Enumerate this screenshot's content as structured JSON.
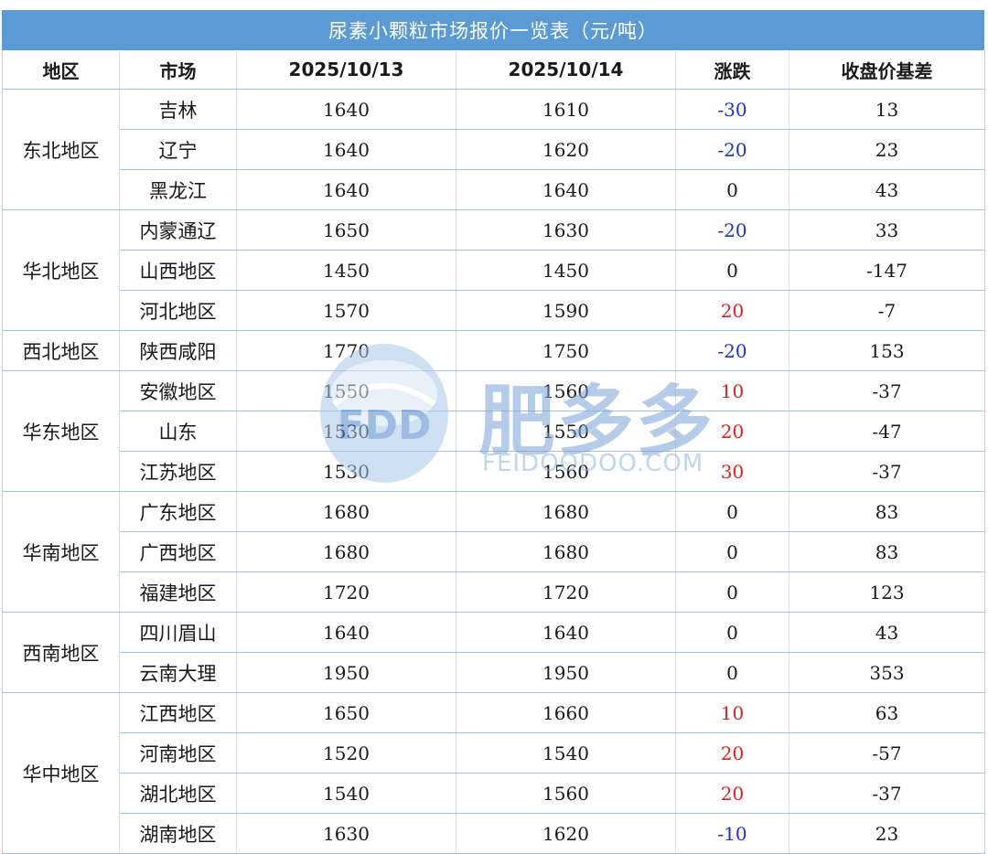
{
  "title": "尿素小颗粒市场报价一览表（元/吨）",
  "headers": [
    "地区",
    "市场",
    "2025/10/13",
    "2025/10/14",
    "涨跌",
    "收盘价基差"
  ],
  "groups": [
    {
      "region": "东北地区",
      "rows": [
        {
          "market": "吉林",
          "d1": "1640",
          "d2": "1610",
          "change": "-30",
          "basis": "13"
        },
        {
          "market": "辽宁",
          "d1": "1640",
          "d2": "1620",
          "change": "-20",
          "basis": "23"
        },
        {
          "market": "黑龙江",
          "d1": "1640",
          "d2": "1640",
          "change": "0",
          "basis": "43"
        }
      ]
    },
    {
      "region": "华北地区",
      "rows": [
        {
          "market": "内蒙通辽",
          "d1": "1650",
          "d2": "1630",
          "change": "-20",
          "basis": "33"
        },
        {
          "market": "山西地区",
          "d1": "1450",
          "d2": "1450",
          "change": "0",
          "basis": "-147"
        },
        {
          "market": "河北地区",
          "d1": "1570",
          "d2": "1590",
          "change": "20",
          "basis": "-7"
        }
      ]
    },
    {
      "region": "西北地区",
      "rows": [
        {
          "market": "陕西咸阳",
          "d1": "1770",
          "d2": "1750",
          "change": "-20",
          "basis": "153"
        }
      ]
    },
    {
      "region": "华东地区",
      "rows": [
        {
          "market": "安徽地区",
          "d1": "1550",
          "d2": "1560",
          "change": "10",
          "basis": "-37"
        },
        {
          "market": "山东",
          "d1": "1530",
          "d2": "1550",
          "change": "20",
          "basis": "-47"
        },
        {
          "market": "江苏地区",
          "d1": "1530",
          "d2": "1560",
          "change": "30",
          "basis": "-37"
        }
      ]
    },
    {
      "region": "华南地区",
      "rows": [
        {
          "market": "广东地区",
          "d1": "1680",
          "d2": "1680",
          "change": "0",
          "basis": "83"
        },
        {
          "market": "广西地区",
          "d1": "1680",
          "d2": "1680",
          "change": "0",
          "basis": "83"
        },
        {
          "market": "福建地区",
          "d1": "1720",
          "d2": "1720",
          "change": "0",
          "basis": "123"
        }
      ]
    },
    {
      "region": "西南地区",
      "rows": [
        {
          "market": "四川眉山",
          "d1": "1640",
          "d2": "1640",
          "change": "0",
          "basis": "43"
        },
        {
          "market": "云南大理",
          "d1": "1950",
          "d2": "1950",
          "change": "0",
          "basis": "353"
        }
      ]
    },
    {
      "region": "华中地区",
      "rows": [
        {
          "market": "江西地区",
          "d1": "1650",
          "d2": "1660",
          "change": "10",
          "basis": "63"
        },
        {
          "market": "河南地区",
          "d1": "1520",
          "d2": "1540",
          "change": "20",
          "basis": "-57"
        },
        {
          "market": "湖北地区",
          "d1": "1540",
          "d2": "1560",
          "change": "20",
          "basis": "-37"
        },
        {
          "market": "湖南地区",
          "d1": "1630",
          "d2": "1620",
          "change": "-10",
          "basis": "23"
        }
      ]
    }
  ],
  "watermark": {
    "logo_text": "FDD",
    "brand": "肥多多",
    "site": "FEIDOODOO.COM"
  },
  "colors": {
    "title_bg": "#5b9bd5",
    "rise": "#e0201f",
    "fall": "#1f2fe0",
    "grid": "#9dc3e6"
  }
}
